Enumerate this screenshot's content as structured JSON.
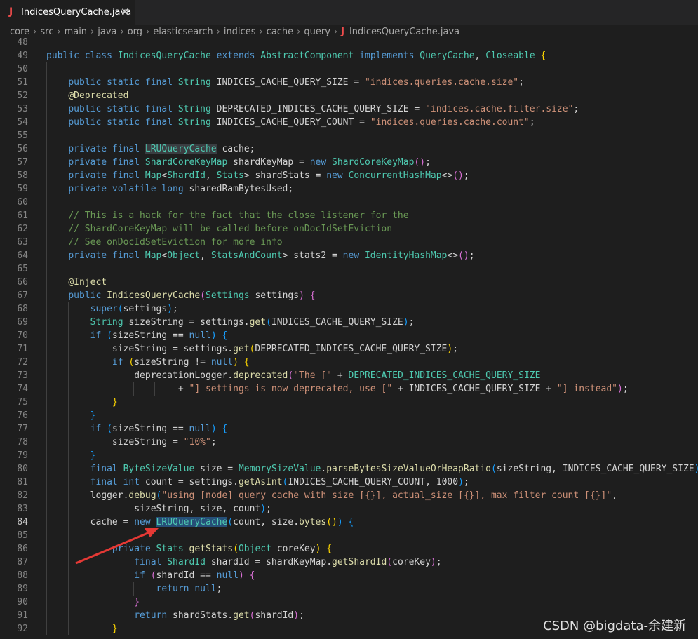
{
  "tab": {
    "icon": "J",
    "title": "IndicesQueryCache.java",
    "close": "✕"
  },
  "breadcrumbs": [
    "core",
    "src",
    "main",
    "java",
    "org",
    "elasticsearch",
    "indices",
    "cache",
    "query",
    "IndicesQueryCache.java"
  ],
  "current_line": 84,
  "lines": [
    {
      "n": "48",
      "t": []
    },
    {
      "n": "49",
      "t": [
        [
          "kw",
          "public "
        ],
        [
          "kw",
          "class "
        ],
        [
          "ty",
          "IndicesQueryCache "
        ],
        [
          "kw",
          "extends "
        ],
        [
          "ty",
          "AbstractComponent "
        ],
        [
          "kw",
          "implements "
        ],
        [
          "ty",
          "QueryCache"
        ],
        [
          "pl",
          ", "
        ],
        [
          "ty",
          "Closeable "
        ],
        [
          "br1",
          "{"
        ]
      ]
    },
    {
      "n": "50",
      "t": []
    },
    {
      "n": "51",
      "t": [
        [
          "pl",
          "    "
        ],
        [
          "kw",
          "public static final "
        ],
        [
          "ty",
          "String "
        ],
        [
          "pl",
          "INDICES_CACHE_QUERY_SIZE = "
        ],
        [
          "st",
          "\"indices.queries.cache.size\""
        ],
        [
          "pl",
          ";"
        ]
      ]
    },
    {
      "n": "52",
      "t": [
        [
          "pl",
          "    "
        ],
        [
          "an",
          "@Deprecated"
        ]
      ]
    },
    {
      "n": "53",
      "t": [
        [
          "pl",
          "    "
        ],
        [
          "kw",
          "public static final "
        ],
        [
          "ty",
          "String "
        ],
        [
          "pl",
          "DEPRECATED_INDICES_CACHE_QUERY_SIZE = "
        ],
        [
          "st",
          "\"indices.cache.filter.size\""
        ],
        [
          "pl",
          ";"
        ]
      ]
    },
    {
      "n": "54",
      "t": [
        [
          "pl",
          "    "
        ],
        [
          "kw",
          "public static final "
        ],
        [
          "ty",
          "String "
        ],
        [
          "pl",
          "INDICES_CACHE_QUERY_COUNT = "
        ],
        [
          "st",
          "\"indices.queries.cache.count\""
        ],
        [
          "pl",
          ";"
        ]
      ]
    },
    {
      "n": "55",
      "t": []
    },
    {
      "n": "56",
      "t": [
        [
          "pl",
          "    "
        ],
        [
          "kw",
          "private final "
        ],
        [
          "ty hl2",
          "LRUQueryCache"
        ],
        [
          "pl",
          " cache;"
        ]
      ]
    },
    {
      "n": "57",
      "t": [
        [
          "pl",
          "    "
        ],
        [
          "kw",
          "private final "
        ],
        [
          "ty",
          "ShardCoreKeyMap "
        ],
        [
          "pl",
          "shardKeyMap = "
        ],
        [
          "kw",
          "new "
        ],
        [
          "ty",
          "ShardCoreKeyMap"
        ],
        [
          "br2",
          "()"
        ],
        [
          "pl",
          ";"
        ]
      ]
    },
    {
      "n": "58",
      "t": [
        [
          "pl",
          "    "
        ],
        [
          "kw",
          "private final "
        ],
        [
          "ty",
          "Map"
        ],
        [
          "pl",
          "<"
        ],
        [
          "ty",
          "ShardId"
        ],
        [
          "pl",
          ", "
        ],
        [
          "ty",
          "Stats"
        ],
        [
          "pl",
          "> shardStats = "
        ],
        [
          "kw",
          "new "
        ],
        [
          "ty",
          "ConcurrentHashMap"
        ],
        [
          "pl",
          "<>"
        ],
        [
          "br2",
          "()"
        ],
        [
          "pl",
          ";"
        ]
      ]
    },
    {
      "n": "59",
      "t": [
        [
          "pl",
          "    "
        ],
        [
          "kw",
          "private volatile long "
        ],
        [
          "pl",
          "sharedRamBytesUsed;"
        ]
      ]
    },
    {
      "n": "60",
      "t": []
    },
    {
      "n": "61",
      "t": [
        [
          "pl",
          "    "
        ],
        [
          "cm",
          "// This is a hack for the fact that the close listener for the"
        ]
      ]
    },
    {
      "n": "62",
      "t": [
        [
          "pl",
          "    "
        ],
        [
          "cm",
          "// ShardCoreKeyMap will be called before onDocIdSetEviction"
        ]
      ]
    },
    {
      "n": "63",
      "t": [
        [
          "pl",
          "    "
        ],
        [
          "cm",
          "// See onDocIdSetEviction for more info"
        ]
      ]
    },
    {
      "n": "64",
      "t": [
        [
          "pl",
          "    "
        ],
        [
          "kw",
          "private final "
        ],
        [
          "ty",
          "Map"
        ],
        [
          "pl",
          "<"
        ],
        [
          "ty",
          "Object"
        ],
        [
          "pl",
          ", "
        ],
        [
          "ty",
          "StatsAndCount"
        ],
        [
          "pl",
          "> stats2 = "
        ],
        [
          "kw",
          "new "
        ],
        [
          "ty",
          "IdentityHashMap"
        ],
        [
          "pl",
          "<>"
        ],
        [
          "br2",
          "()"
        ],
        [
          "pl",
          ";"
        ]
      ]
    },
    {
      "n": "65",
      "t": []
    },
    {
      "n": "66",
      "t": [
        [
          "pl",
          "    "
        ],
        [
          "an",
          "@Inject"
        ]
      ]
    },
    {
      "n": "67",
      "t": [
        [
          "pl",
          "    "
        ],
        [
          "kw",
          "public "
        ],
        [
          "fn",
          "IndicesQueryCache"
        ],
        [
          "br2",
          "("
        ],
        [
          "ty",
          "Settings "
        ],
        [
          "pl",
          "settings"
        ],
        [
          "br2",
          ")"
        ],
        [
          "pl",
          " "
        ],
        [
          "br2",
          "{"
        ]
      ]
    },
    {
      "n": "68",
      "t": [
        [
          "pl",
          "        "
        ],
        [
          "kw",
          "super"
        ],
        [
          "br3",
          "("
        ],
        [
          "pl",
          "settings"
        ],
        [
          "br3",
          ")"
        ],
        [
          "pl",
          ";"
        ]
      ]
    },
    {
      "n": "69",
      "t": [
        [
          "pl",
          "        "
        ],
        [
          "ty",
          "String "
        ],
        [
          "pl",
          "sizeString = settings."
        ],
        [
          "fn",
          "get"
        ],
        [
          "br3",
          "("
        ],
        [
          "pl",
          "INDICES_CACHE_QUERY_SIZE"
        ],
        [
          "br3",
          ")"
        ],
        [
          "pl",
          ";"
        ]
      ]
    },
    {
      "n": "70",
      "t": [
        [
          "pl",
          "        "
        ],
        [
          "kw",
          "if "
        ],
        [
          "br3",
          "("
        ],
        [
          "pl",
          "sizeString == "
        ],
        [
          "kw",
          "null"
        ],
        [
          "br3",
          ")"
        ],
        [
          "pl",
          " "
        ],
        [
          "br3",
          "{"
        ]
      ]
    },
    {
      "n": "71",
      "t": [
        [
          "pl",
          "            sizeString = settings."
        ],
        [
          "fn",
          "get"
        ],
        [
          "br1",
          "("
        ],
        [
          "pl",
          "DEPRECATED_INDICES_CACHE_QUERY_SIZE"
        ],
        [
          "br1",
          ")"
        ],
        [
          "pl",
          ";"
        ]
      ]
    },
    {
      "n": "72",
      "t": [
        [
          "pl",
          "            "
        ],
        [
          "kw",
          "if "
        ],
        [
          "br1",
          "("
        ],
        [
          "pl",
          "sizeString != "
        ],
        [
          "kw",
          "null"
        ],
        [
          "br1",
          ")"
        ],
        [
          "pl",
          " "
        ],
        [
          "br1",
          "{"
        ]
      ]
    },
    {
      "n": "73",
      "t": [
        [
          "pl",
          "                deprecationLogger."
        ],
        [
          "fn",
          "deprecated"
        ],
        [
          "br2",
          "("
        ],
        [
          "st",
          "\"The [\""
        ],
        [
          "pl",
          " + "
        ],
        [
          "ty",
          "DEPRECATED_INDICES_CACHE_QUERY_SIZE"
        ]
      ]
    },
    {
      "n": "74",
      "t": [
        [
          "pl",
          "                        + "
        ],
        [
          "st",
          "\"] settings is now deprecated, use [\""
        ],
        [
          "pl",
          " + INDICES_CACHE_QUERY_SIZE + "
        ],
        [
          "st",
          "\"] instead\""
        ],
        [
          "br2",
          ")"
        ],
        [
          "pl",
          ";"
        ]
      ]
    },
    {
      "n": "75",
      "t": [
        [
          "pl",
          "            "
        ],
        [
          "br1",
          "}"
        ]
      ]
    },
    {
      "n": "76",
      "t": [
        [
          "pl",
          "        "
        ],
        [
          "br3",
          "}"
        ]
      ]
    },
    {
      "n": "77",
      "t": [
        [
          "pl",
          "        "
        ],
        [
          "kw",
          "if "
        ],
        [
          "br3",
          "("
        ],
        [
          "pl",
          "sizeString == "
        ],
        [
          "kw",
          "null"
        ],
        [
          "br3",
          ")"
        ],
        [
          "pl",
          " "
        ],
        [
          "br3",
          "{"
        ]
      ]
    },
    {
      "n": "78",
      "t": [
        [
          "pl",
          "            sizeString = "
        ],
        [
          "st",
          "\"10%\""
        ],
        [
          "pl",
          ";"
        ]
      ]
    },
    {
      "n": "79",
      "t": [
        [
          "pl",
          "        "
        ],
        [
          "br3",
          "}"
        ]
      ]
    },
    {
      "n": "80",
      "t": [
        [
          "pl",
          "        "
        ],
        [
          "kw",
          "final "
        ],
        [
          "ty",
          "ByteSizeValue "
        ],
        [
          "pl",
          "size = "
        ],
        [
          "ty",
          "MemorySizeValue"
        ],
        [
          "pl",
          "."
        ],
        [
          "fn",
          "parseBytesSizeValueOrHeapRatio"
        ],
        [
          "br3",
          "("
        ],
        [
          "pl",
          "sizeString, INDICES_CACHE_QUERY_SIZE"
        ],
        [
          "br3",
          ")"
        ],
        [
          "pl",
          ";"
        ]
      ]
    },
    {
      "n": "81",
      "t": [
        [
          "pl",
          "        "
        ],
        [
          "kw",
          "final int "
        ],
        [
          "pl",
          "count = settings."
        ],
        [
          "fn",
          "getAsInt"
        ],
        [
          "br3",
          "("
        ],
        [
          "pl",
          "INDICES_CACHE_QUERY_COUNT, "
        ],
        [
          "pl",
          "1000"
        ],
        [
          "br3",
          ")"
        ],
        [
          "pl",
          ";"
        ]
      ]
    },
    {
      "n": "82",
      "t": [
        [
          "pl",
          "        logger."
        ],
        [
          "fn",
          "debug"
        ],
        [
          "br3",
          "("
        ],
        [
          "st",
          "\"using [node] query cache with size [{}], actual_size [{}], max filter count [{}]\""
        ],
        [
          "pl",
          ","
        ]
      ]
    },
    {
      "n": "83",
      "t": [
        [
          "pl",
          "                sizeString, size, count"
        ],
        [
          "br3",
          ")"
        ],
        [
          "pl",
          ";"
        ]
      ]
    },
    {
      "n": "84",
      "t": [
        [
          "pl",
          "        cache = "
        ],
        [
          "kw",
          "new "
        ],
        [
          "ty hl",
          "LRUQueryCache"
        ],
        [
          "br3",
          "("
        ],
        [
          "pl",
          "count, size."
        ],
        [
          "fn",
          "bytes"
        ],
        [
          "br1",
          "()"
        ],
        [
          "br3",
          ")"
        ],
        [
          "pl",
          " "
        ],
        [
          "br3",
          "{"
        ]
      ]
    },
    {
      "n": "85",
      "t": []
    },
    {
      "n": "86",
      "t": [
        [
          "pl",
          "            "
        ],
        [
          "kw",
          "private "
        ],
        [
          "ty",
          "Stats "
        ],
        [
          "fn",
          "getStats"
        ],
        [
          "br1",
          "("
        ],
        [
          "ty",
          "Object "
        ],
        [
          "pl",
          "coreKey"
        ],
        [
          "br1",
          ")"
        ],
        [
          "pl",
          " "
        ],
        [
          "br1",
          "{"
        ]
      ]
    },
    {
      "n": "87",
      "t": [
        [
          "pl",
          "                "
        ],
        [
          "kw",
          "final "
        ],
        [
          "ty",
          "ShardId "
        ],
        [
          "pl",
          "shardId = shardKeyMap."
        ],
        [
          "fn",
          "getShardId"
        ],
        [
          "br2",
          "("
        ],
        [
          "pl",
          "coreKey"
        ],
        [
          "br2",
          ")"
        ],
        [
          "pl",
          ";"
        ]
      ]
    },
    {
      "n": "88",
      "t": [
        [
          "pl",
          "                "
        ],
        [
          "kw",
          "if "
        ],
        [
          "br2",
          "("
        ],
        [
          "pl",
          "shardId == "
        ],
        [
          "kw",
          "null"
        ],
        [
          "br2",
          ")"
        ],
        [
          "pl",
          " "
        ],
        [
          "br2",
          "{"
        ]
      ]
    },
    {
      "n": "89",
      "t": [
        [
          "pl",
          "                    "
        ],
        [
          "kw",
          "return null"
        ],
        [
          "pl",
          ";"
        ]
      ]
    },
    {
      "n": "90",
      "t": [
        [
          "pl",
          "                "
        ],
        [
          "br2",
          "}"
        ]
      ]
    },
    {
      "n": "91",
      "t": [
        [
          "pl",
          "                "
        ],
        [
          "kw",
          "return "
        ],
        [
          "pl",
          "shardStats."
        ],
        [
          "fn",
          "get"
        ],
        [
          "br2",
          "("
        ],
        [
          "pl",
          "shardId"
        ],
        [
          "br2",
          ")"
        ],
        [
          "pl",
          ";"
        ]
      ]
    },
    {
      "n": "92",
      "t": [
        [
          "pl",
          "            "
        ],
        [
          "br1",
          "}"
        ]
      ]
    }
  ],
  "watermark": "CSDN @bigdata-余建新"
}
